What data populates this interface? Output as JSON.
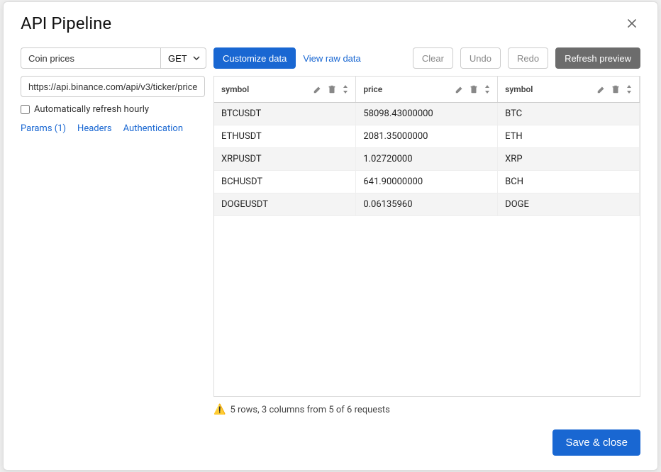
{
  "modal": {
    "title": "API Pipeline"
  },
  "form": {
    "name_value": "Coin prices",
    "method": "GET",
    "url": "https://api.binance.com/api/v3/ticker/price",
    "autorefresh_label": "Automatically refresh hourly",
    "autorefresh_checked": false
  },
  "tabs": {
    "params": "Params (1)",
    "headers": "Headers",
    "auth": "Authentication"
  },
  "toolbar": {
    "customize": "Customize data",
    "view_raw": "View raw data",
    "clear": "Clear",
    "undo": "Undo",
    "redo": "Redo",
    "refresh": "Refresh preview"
  },
  "table": {
    "columns": [
      "symbol",
      "price",
      "symbol"
    ],
    "rows": [
      {
        "c0": "BTCUSDT",
        "c1": "58098.43000000",
        "c2": "BTC"
      },
      {
        "c0": "ETHUSDT",
        "c1": "2081.35000000",
        "c2": "ETH"
      },
      {
        "c0": "XRPUSDT",
        "c1": "1.02720000",
        "c2": "XRP"
      },
      {
        "c0": "BCHUSDT",
        "c1": "641.90000000",
        "c2": "BCH"
      },
      {
        "c0": "DOGEUSDT",
        "c1": "0.06135960",
        "c2": "DOGE"
      }
    ]
  },
  "status": {
    "warn_glyph": "⚠️",
    "text": "5 rows, 3 columns from 5 of 6 requests"
  },
  "footer": {
    "save": "Save & close"
  }
}
